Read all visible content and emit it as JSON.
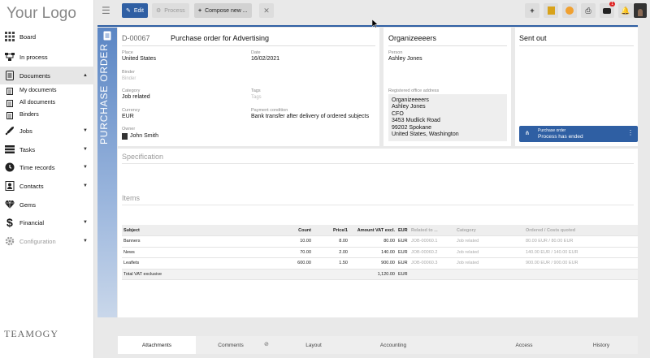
{
  "sidebar": {
    "logo": "Your Logo",
    "items": [
      {
        "label": "Board"
      },
      {
        "label": "In process"
      },
      {
        "label": "Documents"
      },
      {
        "label": "My documents"
      },
      {
        "label": "All documents"
      },
      {
        "label": "Binders"
      },
      {
        "label": "Jobs"
      },
      {
        "label": "Tasks"
      },
      {
        "label": "Time records"
      },
      {
        "label": "Contacts"
      },
      {
        "label": "Gems"
      },
      {
        "label": "Financial"
      },
      {
        "label": "Configuration"
      }
    ],
    "brand": "TEAMOGY"
  },
  "toolbar": {
    "edit": "Edit",
    "process": "Process",
    "compose": "Compose new ...",
    "notification_count": "1"
  },
  "document": {
    "vertical_label": "PURCHASE ORDER",
    "number": "D-00067",
    "title": "Purchase order for Advertising",
    "place_label": "Place",
    "place": "United States",
    "date_label": "Date",
    "date": "16/02/2021",
    "binder_label": "Binder",
    "binder": "Binder",
    "category_label": "Category",
    "category": "Job related",
    "tags_label": "Tags",
    "tags": "Tags",
    "currency_label": "Currency",
    "currency": "EUR",
    "payment_label": "Payment condition",
    "payment": "Bank transfer after delivery of ordered subjects",
    "owner_label": "Owner",
    "owner": "John Smith"
  },
  "company": {
    "name": "Organizeeeers",
    "person_label": "Person",
    "person": "Ashley Jones",
    "address_label": "Registered office address",
    "address_lines": [
      "Organizeeeers",
      "Ashley Jones",
      "CFO",
      "3453 Mudlick Road",
      "99202 Spokane",
      "United States, Washington"
    ]
  },
  "sent_out": {
    "title": "Sent out",
    "process_name": "Purchase order",
    "process_status": "Process has ended"
  },
  "specification": {
    "title": "Specification"
  },
  "items": {
    "title": "Items",
    "headers": [
      "Subject",
      "Count",
      "Price/1",
      "Amount VAT excl.",
      "EUR",
      "Related to ...",
      "Category",
      "Ordered / Costs quoted"
    ],
    "rows": [
      [
        "Banners",
        "10.00",
        "8.00",
        "80.00",
        "EUR",
        "JOB-00060.1",
        "Job related",
        "80.00 EUR / 80.00 EUR"
      ],
      [
        "News",
        "70.00",
        "2.00",
        "140.00",
        "EUR",
        "JOB-00060.2",
        "Job related",
        "140.00 EUR / 140.00 EUR"
      ],
      [
        "Leaflets",
        "600.00",
        "1.50",
        "900.00",
        "EUR",
        "JOB-00060.3",
        "Job related",
        "900.00 EUR / 900.00 EUR"
      ]
    ],
    "total_label": "Total VAT exclusive",
    "total_value": "1,120.00",
    "total_currency": "EUR"
  },
  "tabs": [
    "Attachments",
    "Comments",
    "Layout",
    "Accounting",
    "Access",
    "History"
  ],
  "colors": {
    "accent": "#2f5fa3",
    "band": "#6e93c9"
  }
}
